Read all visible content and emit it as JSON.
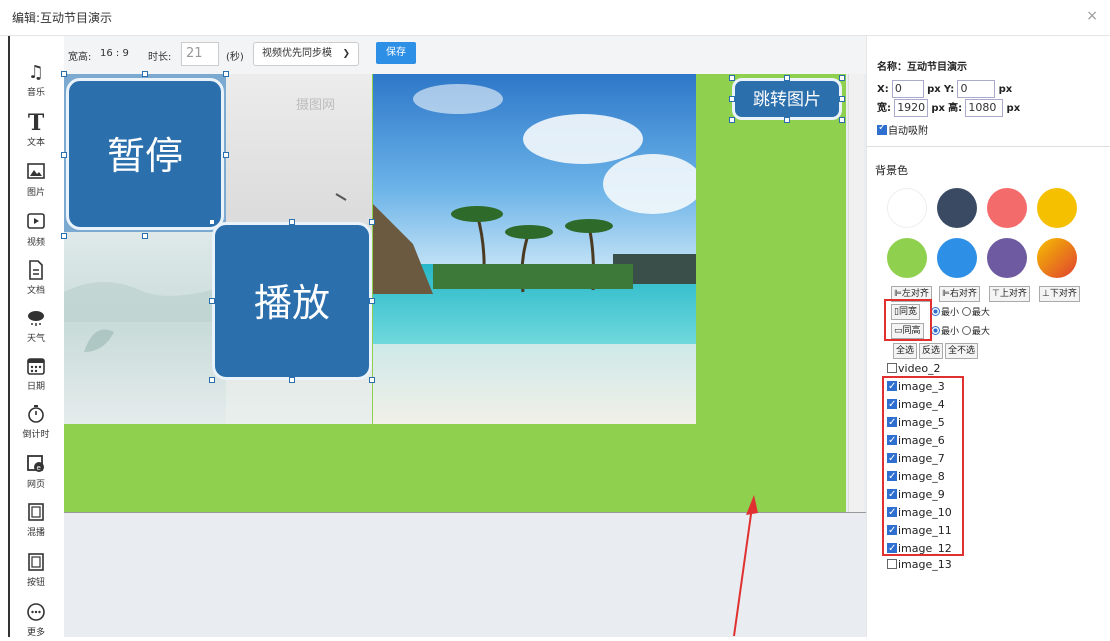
{
  "window": {
    "title": "编辑:互动节目演示",
    "close": "×"
  },
  "tools": [
    {
      "label": "音乐",
      "icon": "music-icon"
    },
    {
      "label": "文本",
      "icon": "text-icon"
    },
    {
      "label": "图片",
      "icon": "image-icon"
    },
    {
      "label": "视频",
      "icon": "video-icon"
    },
    {
      "label": "文档",
      "icon": "document-icon"
    },
    {
      "label": "天气",
      "icon": "weather-icon"
    },
    {
      "label": "日期",
      "icon": "calendar-icon"
    },
    {
      "label": "倒计时",
      "icon": "stopwatch-icon"
    },
    {
      "label": "网页",
      "icon": "webpage-icon"
    },
    {
      "label": "混播",
      "icon": "film-icon"
    },
    {
      "label": "按钮",
      "icon": "button-icon"
    },
    {
      "label": "更多",
      "icon": "more-icon"
    }
  ],
  "toolbar": {
    "ratio_label": "宽高:",
    "ratio_value": "16 : 9",
    "duration_label": "时长:",
    "duration_value": "21",
    "duration_unit": "(秒)",
    "sync_select": "视频优先同步模",
    "save_label": "保存"
  },
  "canvas": {
    "pause_label": "暂停",
    "play_label": "播放",
    "jump_label": "跳转图片",
    "watermark": "摄图网"
  },
  "props": {
    "name_label": "名称：",
    "name_value": "互动节目演示",
    "x_label": "X:",
    "x_value": "0",
    "y_label": "Y:",
    "y_value": "0",
    "px": "px",
    "w_label": "宽:",
    "w_value": "1920",
    "h_label": "高:",
    "h_value": "1080",
    "snap_label": "自动吸附"
  },
  "bg": {
    "label": "背景色",
    "colors": [
      "#ffffff",
      "#3b4a63",
      "#f36b6b",
      "#f5c000",
      "#8fd14f",
      "#2e8fe6",
      "#6e5aa0",
      "gradient"
    ]
  },
  "align": {
    "left": "左对齐",
    "right": "右对齐",
    "top": "上对齐",
    "bottom": "下对齐",
    "same_width": "同宽",
    "same_height": "同高",
    "min": "最小",
    "max": "最大",
    "select_all": "全选",
    "invert": "反选",
    "select_none": "全不选"
  },
  "layers": [
    {
      "name": "video_2",
      "checked": false
    },
    {
      "name": "image_3",
      "checked": true
    },
    {
      "name": "image_4",
      "checked": true
    },
    {
      "name": "image_5",
      "checked": true
    },
    {
      "name": "image_6",
      "checked": true
    },
    {
      "name": "image_7",
      "checked": true
    },
    {
      "name": "image_8",
      "checked": true
    },
    {
      "name": "image_9",
      "checked": true
    },
    {
      "name": "image_10",
      "checked": true
    },
    {
      "name": "image_11",
      "checked": true
    },
    {
      "name": "image_12",
      "checked": true
    },
    {
      "name": "image_13",
      "checked": false
    }
  ]
}
